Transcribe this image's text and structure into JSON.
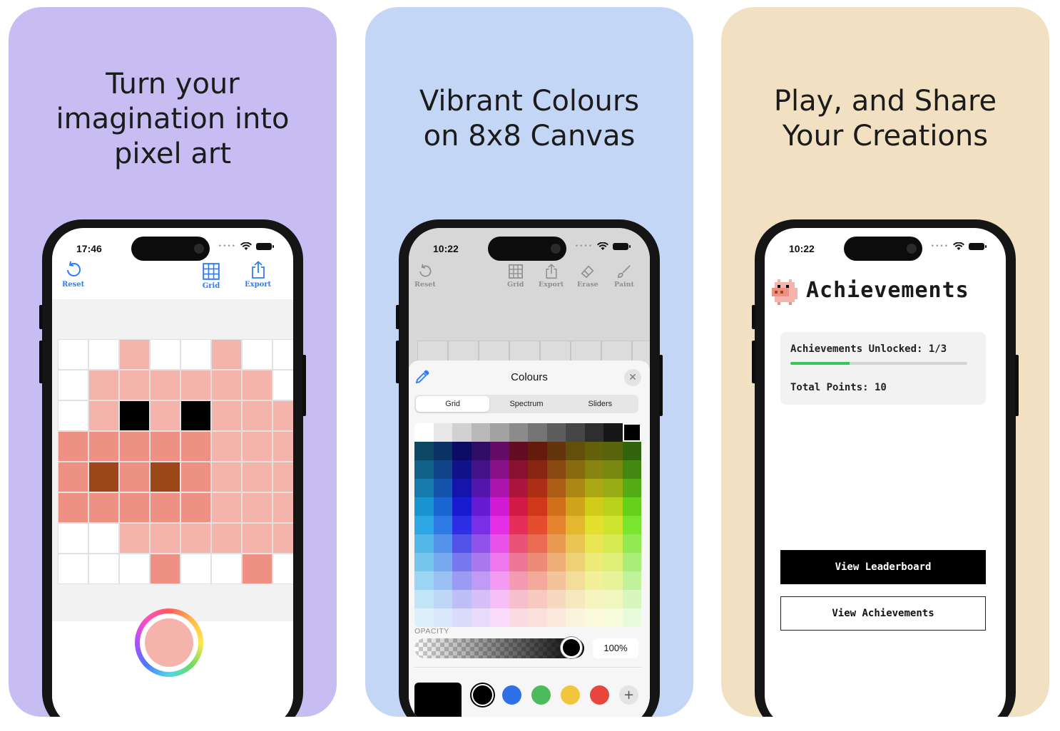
{
  "cards": [
    {
      "headline": "Turn your\nimagination into\npixel art",
      "phone": {
        "time": "17:46",
        "toolbar": {
          "reset": "Reset",
          "grid": "Grid",
          "export": "Export"
        },
        "canvas_size": "8x8",
        "pixels": [
          [
            "#ffffff",
            "#ffffff",
            "#f4b4ac",
            "#ffffff",
            "#ffffff",
            "#f4b4ac",
            "#ffffff",
            "#ffffff"
          ],
          [
            "#ffffff",
            "#f4b4ac",
            "#f4b4ac",
            "#f4b4ac",
            "#f4b4ac",
            "#f4b4ac",
            "#f4b4ac",
            "#ffffff"
          ],
          [
            "#ffffff",
            "#f4b4ac",
            "#000000",
            "#f4b4ac",
            "#000000",
            "#f4b4ac",
            "#f4b4ac",
            "#f4b4ac"
          ],
          [
            "#ee9184",
            "#ee9184",
            "#ee9184",
            "#ee9184",
            "#ee9184",
            "#f4b4ac",
            "#f4b4ac",
            "#f4b4ac"
          ],
          [
            "#ee9184",
            "#9c4718",
            "#ee9184",
            "#9c4718",
            "#ee9184",
            "#f4b4ac",
            "#f4b4ac",
            "#f4b4ac"
          ],
          [
            "#ee9184",
            "#ee9184",
            "#ee9184",
            "#ee9184",
            "#ee9184",
            "#f4b4ac",
            "#f4b4ac",
            "#f4b4ac"
          ],
          [
            "#ffffff",
            "#ffffff",
            "#f4b4ac",
            "#f4b4ac",
            "#f4b4ac",
            "#f4b4ac",
            "#f4b4ac",
            "#f4b4ac"
          ],
          [
            "#ffffff",
            "#ffffff",
            "#ffffff",
            "#ee9184",
            "#ffffff",
            "#ffffff",
            "#ee9184",
            "#ffffff"
          ]
        ],
        "selected_color": "#f4b4ac"
      }
    },
    {
      "headline": "Vibrant Colours\non 8x8 Canvas",
      "phone": {
        "time": "10:22",
        "toolbar": {
          "reset": "Reset",
          "grid": "Grid",
          "export": "Export",
          "erase": "Erase",
          "paint": "Paint"
        },
        "sheet": {
          "title": "Colours",
          "tabs": [
            "Grid",
            "Spectrum",
            "Sliders"
          ],
          "active_tab": "Grid",
          "opacity_label": "OPACITY",
          "opacity_value": "100%",
          "opacity_level": 1.0,
          "current_color": "#000000",
          "swatches": [
            "#000000",
            "#2f6fe8",
            "#4cbb5c",
            "#f2c53d",
            "#e8453c"
          ],
          "add_label": "+"
        }
      }
    },
    {
      "headline": "Play, and Share\nYour Creations",
      "phone": {
        "time": "10:22",
        "title": "Achievements",
        "unlocked_text": "Achievements Unlocked: 1/3",
        "unlocked_progress": 0.333,
        "points_text": "Total Points: 10",
        "leaderboard_button": "View Leaderboard",
        "achievements_button": "View Achievements"
      }
    }
  ],
  "colors": {
    "card1_bg": "#c7bdf3",
    "card2_bg": "#c4d6f5",
    "card3_bg": "#f1e1c2",
    "accent_blue": "#2f7bf6",
    "progress_green": "#35c759"
  }
}
